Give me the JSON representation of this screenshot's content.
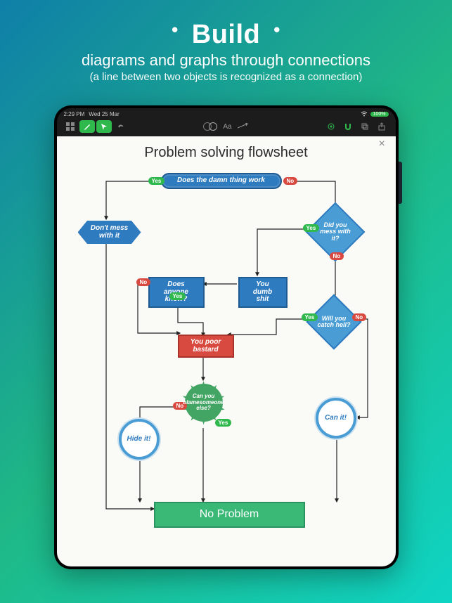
{
  "hero": {
    "title": "Build",
    "subtitle": "diagrams and graphs through connections",
    "note": "(a line between two objects is recognized as a connection)"
  },
  "status": {
    "time": "2:29 PM",
    "date": "Wed 25 Mar",
    "battery": "100%"
  },
  "toolbar": {
    "text_label": "Aa"
  },
  "canvas": {
    "title": "Problem solving flowsheet"
  },
  "nodes": {
    "n1": "Does the damn thing work",
    "n2": "Don't mess with it",
    "n3": "Did you mess with it?",
    "n4": "Does anyone know?",
    "n5": "You dumb shit",
    "n6": "You poor bastard",
    "n7": "Will you catch hell?",
    "n8": "Can you blamesomeone else?",
    "n9": "Hide it!",
    "n10": "Can it!",
    "n11": "No Problem"
  },
  "labels": {
    "yes": "Yes",
    "no": "No"
  }
}
